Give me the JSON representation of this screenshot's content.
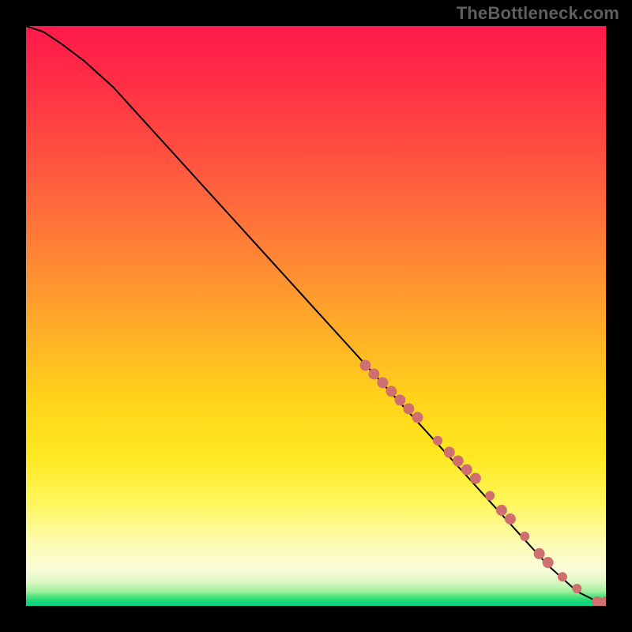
{
  "watermark": "TheBottleneck.com",
  "colors": {
    "dot": "#cf6f6f",
    "curve": "#000000",
    "frame_bg": "#000000"
  },
  "chart_data": {
    "type": "line",
    "title": "",
    "xlabel": "",
    "ylabel": "",
    "xlim": [
      0,
      100
    ],
    "ylim": [
      0,
      100
    ],
    "grid": false,
    "series": [
      {
        "name": "curve",
        "x": [
          0,
          3,
          6,
          10,
          15,
          20,
          25,
          30,
          35,
          40,
          45,
          50,
          55,
          60,
          65,
          70,
          75,
          80,
          85,
          90,
          95,
          99,
          100
        ],
        "y": [
          100,
          99,
          97,
          94,
          89.5,
          84,
          78.5,
          73,
          67.5,
          62,
          56.5,
          51,
          45.5,
          40,
          34.5,
          29,
          23.5,
          18,
          12.5,
          7,
          2.5,
          0.5,
          0.5
        ]
      }
    ],
    "points": [
      {
        "name": "cluster-1",
        "x": 58.5,
        "y": 41.5,
        "r": 7
      },
      {
        "name": "cluster-1b",
        "x": 60.0,
        "y": 40.0,
        "r": 7
      },
      {
        "name": "cluster-1c",
        "x": 61.5,
        "y": 38.5,
        "r": 7
      },
      {
        "name": "cluster-1d",
        "x": 63.0,
        "y": 37.0,
        "r": 7
      },
      {
        "name": "cluster-1e",
        "x": 64.5,
        "y": 35.5,
        "r": 7
      },
      {
        "name": "cluster-1f",
        "x": 66.0,
        "y": 34.0,
        "r": 7
      },
      {
        "name": "cluster-1g",
        "x": 67.5,
        "y": 32.5,
        "r": 7
      },
      {
        "name": "gap-a",
        "x": 71.0,
        "y": 28.5,
        "r": 6
      },
      {
        "name": "cluster-2a",
        "x": 73.0,
        "y": 26.5,
        "r": 7
      },
      {
        "name": "cluster-2b",
        "x": 74.5,
        "y": 25.0,
        "r": 7
      },
      {
        "name": "cluster-2c",
        "x": 76.0,
        "y": 23.5,
        "r": 7
      },
      {
        "name": "cluster-2d",
        "x": 77.5,
        "y": 22.0,
        "r": 7
      },
      {
        "name": "spot-a",
        "x": 80.0,
        "y": 19.0,
        "r": 6
      },
      {
        "name": "cluster-3a",
        "x": 82.0,
        "y": 16.5,
        "r": 7
      },
      {
        "name": "cluster-3b",
        "x": 83.5,
        "y": 15.0,
        "r": 7
      },
      {
        "name": "spot-b",
        "x": 86.0,
        "y": 12.0,
        "r": 6
      },
      {
        "name": "cluster-4a",
        "x": 88.5,
        "y": 9.0,
        "r": 7
      },
      {
        "name": "cluster-4b",
        "x": 90.0,
        "y": 7.5,
        "r": 7
      },
      {
        "name": "spot-c",
        "x": 92.5,
        "y": 5.0,
        "r": 6
      },
      {
        "name": "spot-d",
        "x": 95.0,
        "y": 3.0,
        "r": 6
      },
      {
        "name": "end-1",
        "x": 98.5,
        "y": 0.7,
        "r": 7
      },
      {
        "name": "end-2",
        "x": 100.0,
        "y": 0.7,
        "r": 7
      }
    ]
  }
}
